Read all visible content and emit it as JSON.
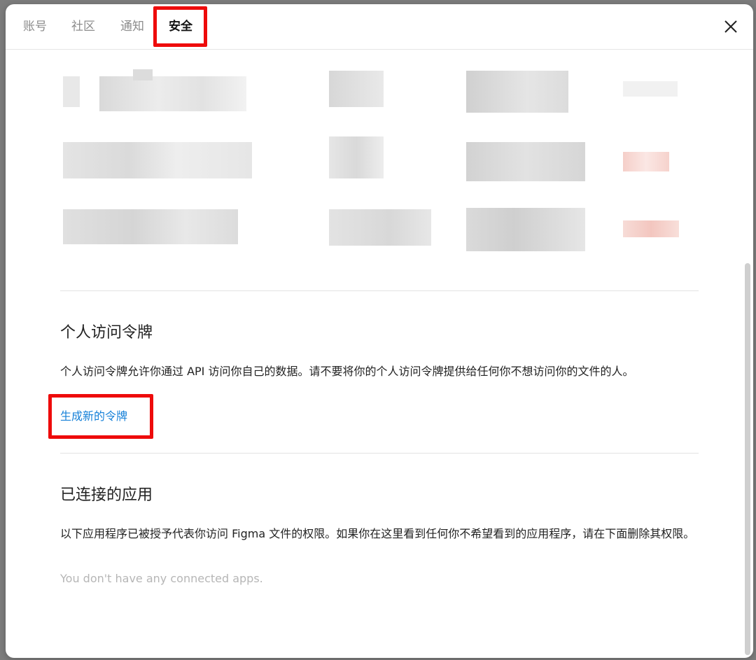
{
  "tabs": [
    {
      "label": "账号"
    },
    {
      "label": "社区"
    },
    {
      "label": "通知"
    },
    {
      "label": "安全"
    }
  ],
  "close_icon": "close-icon",
  "sessions_blurred": true,
  "personal_token": {
    "title": "个人访问令牌",
    "description": "个人访问令牌允许你通过 API 访问你自己的数据。请不要将你的个人访问令牌提供给任何你不想访问你的文件的人。",
    "generate_link": "生成新的令牌"
  },
  "connected_apps": {
    "title": "已连接的应用",
    "description": "以下应用程序已被授予代表你访问 Figma 文件的权限。如果你在这里看到任何你不希望看到的应用程序，请在下面删除其权限。",
    "empty_note": "You don't have any connected apps."
  },
  "colors": {
    "link": "#1580d8",
    "highlight_box": "#ee0b0b"
  }
}
